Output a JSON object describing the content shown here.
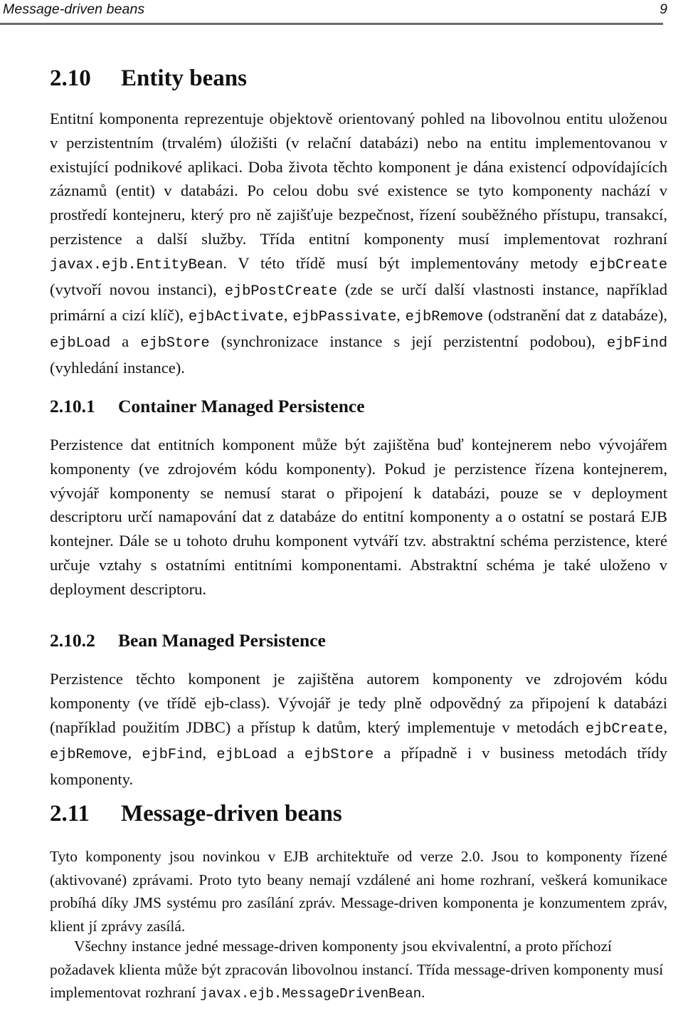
{
  "document": {
    "language": "cs",
    "page_number": "9",
    "colors": {
      "text": "#111111",
      "rule": "#6b6b6b",
      "background": "#ffffff"
    }
  },
  "header": {
    "title": "Message-driven beans",
    "page_number": "9"
  },
  "sections": [
    {
      "number": "2.10",
      "title": "Entity beans",
      "paragraphs": [
        {
          "id": "p_entity_intro",
          "runs": [
            {
              "type": "text",
              "text": "Entitní komponenta reprezentuje objektově orientovaný pohled na libovolnou entitu uloženou v perzistentním (trvalém) úložišti (v relační databázi) nebo na entitu implementovanou v existující podnikové aplikaci. Doba života těchto komponent je dána existencí odpovídajících záznamů (entit) v databázi. Po celou dobu své existence se tyto komponenty nachází v prostředí kontejneru, který pro ně zajišťuje bezpečnost, řízení souběžného přístupu, transakcí, perzistence a další služby. Třída entitní komponenty musí implementovat rozhraní "
            },
            {
              "type": "code",
              "text": "javax.ejb.EntityBean"
            },
            {
              "type": "text",
              "text": ". V této třídě musí být implementovány metody "
            },
            {
              "type": "code",
              "text": "ejbCreate"
            },
            {
              "type": "text",
              "text": " (vytvoří novou instanci), "
            },
            {
              "type": "code",
              "text": "ejbPostCreate"
            },
            {
              "type": "text",
              "text": " (zde se určí další vlastnosti instance, například primární a cizí klíč), "
            },
            {
              "type": "code",
              "text": "ejbActivate"
            },
            {
              "type": "text",
              "text": ", "
            },
            {
              "type": "code",
              "text": "ejbPassivate"
            },
            {
              "type": "text",
              "text": ", "
            },
            {
              "type": "code",
              "text": "ejbRemove"
            },
            {
              "type": "text",
              "text": " (odstranění dat z databáze), "
            },
            {
              "type": "code",
              "text": "ejbLoad"
            },
            {
              "type": "text",
              "text": " a "
            },
            {
              "type": "code",
              "text": "ejbStore"
            },
            {
              "type": "text",
              "text": " (synchronizace instance s její perzistentní podobou), "
            },
            {
              "type": "code",
              "text": "ejbFind"
            },
            {
              "type": "text",
              "text": " (vyhledání instance)."
            }
          ]
        }
      ],
      "subsections": [
        {
          "number": "2.10.1",
          "title": "Container Managed Persistence",
          "paragraphs": [
            {
              "id": "p_cmp",
              "runs": [
                {
                  "type": "text",
                  "text": "Perzistence dat entitních komponent může být zajištěna buď kontejnerem nebo vývojářem komponenty (ve zdrojovém kódu komponenty). Pokud je perzistence řízena kontejnerem, vývojář komponenty se nemusí starat o připojení k databázi, pouze se v deployment descriptoru určí namapování dat z databáze do entitní komponenty a o ostatní se postará EJB kontejner. Dále se u tohoto druhu komponent vytváří tzv. abstraktní schéma perzistence, které určuje vztahy s ostatními entitními komponentami. Abstraktní schéma je také uloženo v deployment descriptoru."
                }
              ]
            }
          ]
        },
        {
          "number": "2.10.2",
          "title": "Bean Managed Persistence",
          "paragraphs": [
            {
              "id": "p_bmp",
              "runs": [
                {
                  "type": "text",
                  "text": "Perzistence těchto komponent je zajištěna autorem komponenty ve zdrojovém kódu komponenty (ve třídě ejb-class). Vývojář je tedy plně odpovědný za připojení k databázi (například použitím JDBC) a přístup k datům, který implementuje v metodách "
                },
                {
                  "type": "code",
                  "text": "ejbCreate"
                },
                {
                  "type": "text",
                  "text": ", "
                },
                {
                  "type": "code",
                  "text": "ejbRemove"
                },
                {
                  "type": "text",
                  "text": ", "
                },
                {
                  "type": "code",
                  "text": "ejbFind"
                },
                {
                  "type": "text",
                  "text": ", "
                },
                {
                  "type": "code",
                  "text": "ejbLoad"
                },
                {
                  "type": "text",
                  "text": " a "
                },
                {
                  "type": "code",
                  "text": "ejbStore"
                },
                {
                  "type": "text",
                  "text": " a případně i v business metodách třídy komponenty."
                }
              ]
            }
          ]
        }
      ]
    },
    {
      "number": "2.11",
      "title": "Message-driven beans",
      "paragraphs": [
        {
          "id": "p_mdb_1",
          "runs": [
            {
              "type": "text",
              "text": "Tyto komponenty jsou novinkou v EJB architektuře od verze 2.0. Jsou to komponenty řízené (aktivované) zprávami. Proto tyto beany nemají vzdálené ani home rozhraní, veškerá komunikace probíhá díky JMS systému pro zasílání zpráv. Message-driven komponenta je konzumentem zpráv, klient jí zprávy zasílá."
            }
          ]
        },
        {
          "id": "p_mdb_2",
          "indent": true,
          "runs": [
            {
              "type": "text",
              "text": "Všechny instance jedné message-driven komponenty jsou ekvivalentní, a proto příchozí požadavek klienta může být zpracován libovolnou instancí. Třída message-driven komponenty musí implementovat rozhraní "
            },
            {
              "type": "code",
              "text": "javax.ejb.MessageDrivenBean"
            },
            {
              "type": "text",
              "text": "."
            }
          ]
        }
      ]
    }
  ]
}
